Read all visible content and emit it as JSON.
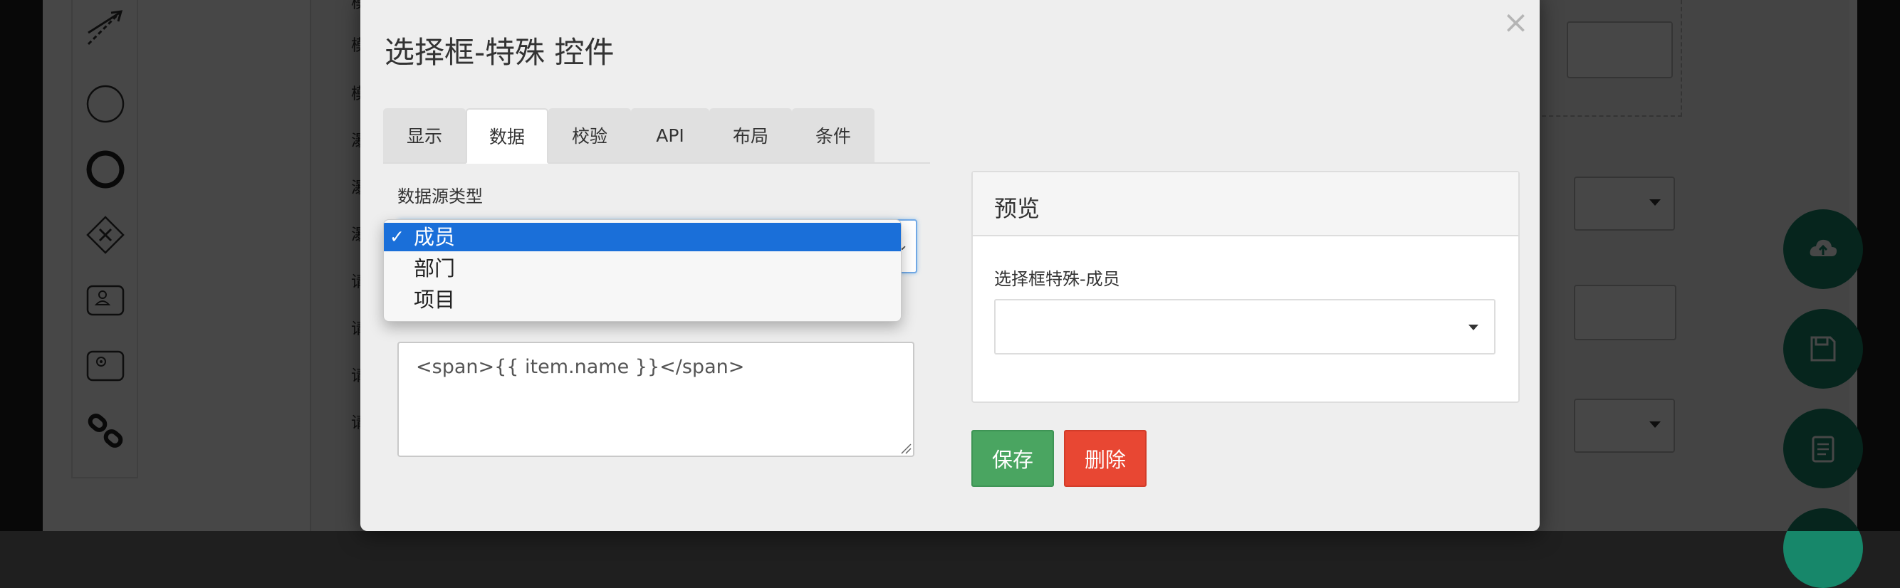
{
  "modal": {
    "title": "选择框-特殊 控件",
    "close_label": "×",
    "tabs": [
      {
        "label": "显示",
        "active": false
      },
      {
        "label": "数据",
        "active": true
      },
      {
        "label": "校验",
        "active": false
      },
      {
        "label": "API",
        "active": false
      },
      {
        "label": "布局",
        "active": false
      },
      {
        "label": "条件",
        "active": false
      }
    ],
    "data_source": {
      "label": "数据源类型",
      "options": [
        {
          "label": "成员",
          "selected": true,
          "check": "✓"
        },
        {
          "label": "部门",
          "selected": false,
          "check": ""
        },
        {
          "label": "项目",
          "selected": false,
          "check": ""
        }
      ]
    },
    "template_value": "<span>{{ item.name }}</span>",
    "preview": {
      "title": "预览",
      "field_label": "选择框特殊-成员",
      "select_value": ""
    },
    "save_label": "保存",
    "delete_label": "删除"
  },
  "background": {
    "side_labels": [
      "模",
      "模",
      "模",
      "瀑",
      "瀑",
      "瀑",
      "请",
      "请",
      "请",
      "请"
    ],
    "tool_icons": [
      "arrow-tool-icon",
      "circle-icon",
      "thick-circle-icon",
      "diamond-x-icon",
      "user-task-icon",
      "service-task-icon",
      "link-icon"
    ],
    "fab_icons": [
      "cloud-upload-icon",
      "floppy-disk-icon",
      "clipboard-icon"
    ]
  },
  "colors": {
    "selected_option": "#1a6fd9",
    "save_button": "#4aa561",
    "delete_button": "#e84733",
    "fab": "#17876a"
  }
}
